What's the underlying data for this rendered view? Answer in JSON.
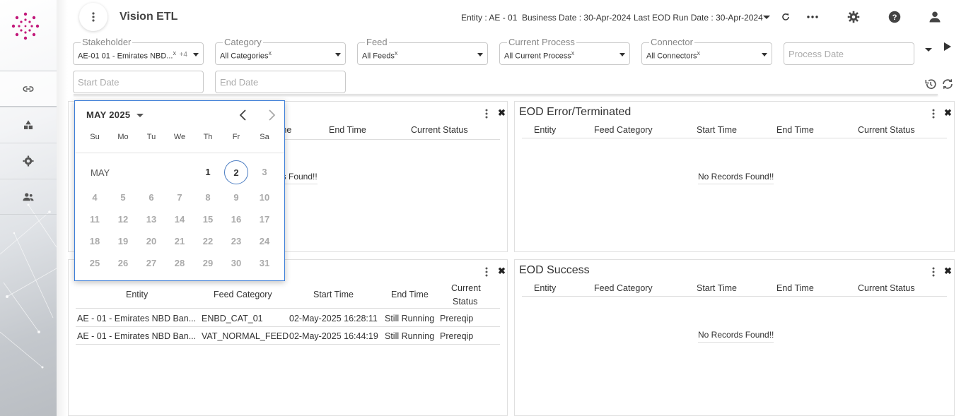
{
  "header": {
    "app_title": "Vision ETL",
    "entity_label": "Entity :",
    "entity_value": "AE - 01",
    "business_date_label": "Business Date :",
    "business_date_value": "30-Apr-2024",
    "last_eod_label": "Last EOD Run Date :",
    "last_eod_value": "30-Apr-2024"
  },
  "filters": {
    "stakeholder": {
      "label": "Stakeholder",
      "value": "AE-01 01 - Emirates NBD...",
      "clear": "x",
      "extra": "+4"
    },
    "category": {
      "label": "Category",
      "value": "All Categories",
      "clear": "x"
    },
    "feed": {
      "label": "Feed",
      "value": "All Feeds",
      "clear": "x"
    },
    "current_process": {
      "label": "Current Process",
      "value": "All Current Process",
      "clear": "x"
    },
    "connector": {
      "label": "Connector",
      "value": "All Connectors",
      "clear": "x"
    },
    "process_date": {
      "placeholder": "Process Date"
    },
    "start_date": {
      "placeholder": "Start Date"
    },
    "end_date": {
      "placeholder": "End Date"
    }
  },
  "panels": {
    "top_left": {
      "headers_visible": [
        "me",
        "End Time",
        "Current Status"
      ],
      "no_records": "ds Found!!"
    },
    "top_right": {
      "title": "EOD Error/Terminated",
      "headers": [
        "Entity",
        "Feed Category",
        "Start Time",
        "End Time",
        "Current Status"
      ],
      "no_records": "No Records Found!!"
    },
    "bottom_left": {
      "headers": [
        "Entity",
        "Feed Category",
        "Start Time",
        "End Time",
        "Current",
        "Status"
      ],
      "rows": [
        [
          "AE - 01 - Emirates NBD Ban...",
          "ENBD_CAT_01",
          "02-May-2025 16:28:11",
          "Still Running",
          "Prereqip"
        ],
        [
          "AE - 01 - Emirates NBD Ban...",
          "VAT_NORMAL_FEED",
          "02-May-2025 16:44:19",
          "Still Running",
          "Prereqip"
        ]
      ]
    },
    "bottom_right": {
      "title": "EOD Success",
      "headers": [
        "Entity",
        "Feed Category",
        "Start Time",
        "End Time",
        "Current Status"
      ],
      "no_records": "No Records Found!!"
    }
  },
  "calendar": {
    "month_year": "MAY 2025",
    "month_label": "MAY",
    "weekdays": [
      "Su",
      "Mo",
      "Tu",
      "We",
      "Th",
      "Fr",
      "Sa"
    ],
    "days": [
      "1",
      "2",
      "3",
      "4",
      "5",
      "6",
      "7",
      "8",
      "9",
      "10",
      "11",
      "12",
      "13",
      "14",
      "15",
      "16",
      "17",
      "18",
      "19",
      "20",
      "21",
      "22",
      "23",
      "24",
      "25",
      "26",
      "27",
      "28",
      "29",
      "30",
      "31"
    ],
    "selected_day": "2"
  },
  "colors": {
    "accent": "#3b7dd8",
    "logo": "#c2187a"
  }
}
